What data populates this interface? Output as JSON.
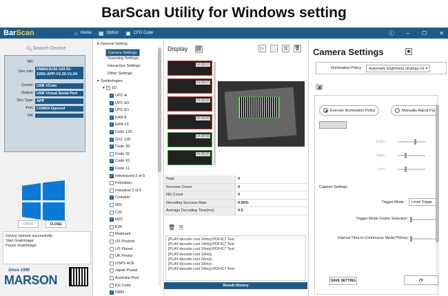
{
  "banner_title": "BarScan Utility for Windows setting",
  "app": {
    "logo_a": "Bar",
    "logo_b": "Scan",
    "nav": [
      {
        "icon": "home-icon",
        "glyph": "⌂",
        "label": "Home"
      },
      {
        "icon": "grid-icon",
        "glyph": "▦",
        "label": "Option"
      },
      {
        "icon": "qr-icon",
        "glyph": "▣",
        "label": "CFG Code"
      }
    ],
    "win_info": "ⓘ",
    "win_min": "–",
    "win_max": "☐",
    "win_close": "✕"
  },
  "left": {
    "search_label": "Search Device",
    "device_rows": [
      {
        "k": "Mfr:",
        "v": ""
      },
      {
        "k": "Dev Info:",
        "v": "FM8413U30-100-01-100G-APP-V2.20-V1.04"
      },
      {
        "k": "Comm:",
        "v": "USB VCom"
      },
      {
        "k": "Output:",
        "v": "USB Virtual Serial Port"
      },
      {
        "k": "Dev Type:",
        "v": "APP"
      },
      {
        "k": "Port:",
        "v": "COM24-Opened"
      },
      {
        "k": "SN:",
        "v": ""
      }
    ],
    "open_label": "OPEN",
    "close_label": "CLOSE",
    "log": [
      "Device opened successfully.",
      "Start GrabImage",
      "Pause GrabImage"
    ],
    "brand_since": "Since 1990",
    "brand_name": "MARSON"
  },
  "tree": {
    "general": "General Setting",
    "general_items": [
      "Camera Settings",
      "Scanning Settings",
      "Interactive Settings",
      "Other Settings"
    ],
    "symbologies": "Symbologies",
    "oned": "1D",
    "items": [
      {
        "label": "UPC-A",
        "on": true
      },
      {
        "label": "UPC-E0",
        "on": true
      },
      {
        "label": "UPC-E1",
        "on": true
      },
      {
        "label": "EAN-8",
        "on": true
      },
      {
        "label": "EAN-13",
        "on": true
      },
      {
        "label": "Code 128",
        "on": true
      },
      {
        "label": "GS1 128",
        "on": true
      },
      {
        "label": "Code 39",
        "on": true
      },
      {
        "label": "Code 32",
        "on": false
      },
      {
        "label": "Code 93",
        "on": true
      },
      {
        "label": "Code 11",
        "on": true
      },
      {
        "label": "Interleaved 2 of 5",
        "on": true
      },
      {
        "label": "Febraban",
        "on": false
      },
      {
        "label": "Industrial 2 of 5",
        "on": false
      },
      {
        "label": "Codabar",
        "on": true
      },
      {
        "label": "MSI",
        "on": false
      },
      {
        "label": "C25",
        "on": false
      },
      {
        "label": "M25",
        "on": true
      },
      {
        "label": "K35",
        "on": false
      },
      {
        "label": "Mailmark",
        "on": false
      },
      {
        "label": "US Postnet",
        "on": false
      },
      {
        "label": "US Planet",
        "on": false
      },
      {
        "label": "UK Postal",
        "on": false
      },
      {
        "label": "USPS 4CB",
        "on": false
      },
      {
        "label": "Japan Postal",
        "on": false
      },
      {
        "label": "Australia Post",
        "on": false
      },
      {
        "label": "Kix Code",
        "on": false
      },
      {
        "label": "ISBN",
        "on": true
      }
    ]
  },
  "display": {
    "title": "Display",
    "thumbs": [
      {
        "time": "14:38:07",
        "ok": false
      },
      {
        "time": "14:38:07",
        "ok": false
      },
      {
        "time": "14:38:06",
        "ok": false
      },
      {
        "time": "14:38:06",
        "ok": false
      },
      {
        "time": "14:38:06",
        "ok": true
      },
      {
        "time": "14:38:06",
        "ok": true
      }
    ],
    "stats": [
      {
        "k": "Total",
        "v": "0"
      },
      {
        "k": "Success Count",
        "v": "0"
      },
      {
        "k": "NG Count",
        "v": "0"
      },
      {
        "k": "Decoding Success Rate",
        "v": "0.00%"
      },
      {
        "k": "Average Decoding Time(ms)",
        "v": "0.0"
      }
    ],
    "results": [
      "[PLAY-decode cost 20ms]:PDF417 Test",
      "[PLAY-decode cost 19ms]:PDF417 Test",
      "[PLAY-decode cost 19ms]:PDF417 Test",
      "[PLAY-decode cost 19ms]:",
      "[PLAY-decode cost 66ms]:",
      "[PLAY-decode cost 18ms]:",
      "[PLAY-decode cost 20ms]:PDF417 Test"
    ],
    "history_label": "Result History"
  },
  "camera": {
    "title": "Camera Settings",
    "illum_label": "Illumination Policy :",
    "illum_value": "Automatic brightness strategy H1",
    "radio_exec": "Execute Illumination Policy",
    "radio_manual": "Manually Adjust Par",
    "expo": "Expo :",
    "gain": "Gain :",
    "lum": "Lum :",
    "capture": "Capture Settings",
    "trigger_mode_label": "Trigger Mode :",
    "trigger_mode_value": "Level Trigge",
    "frame_sel": "Trigger Mode Frame Selection:",
    "interval": "Interval Time In Continuous Mode(*50ms):",
    "save_label": "SAVE SETTING"
  }
}
